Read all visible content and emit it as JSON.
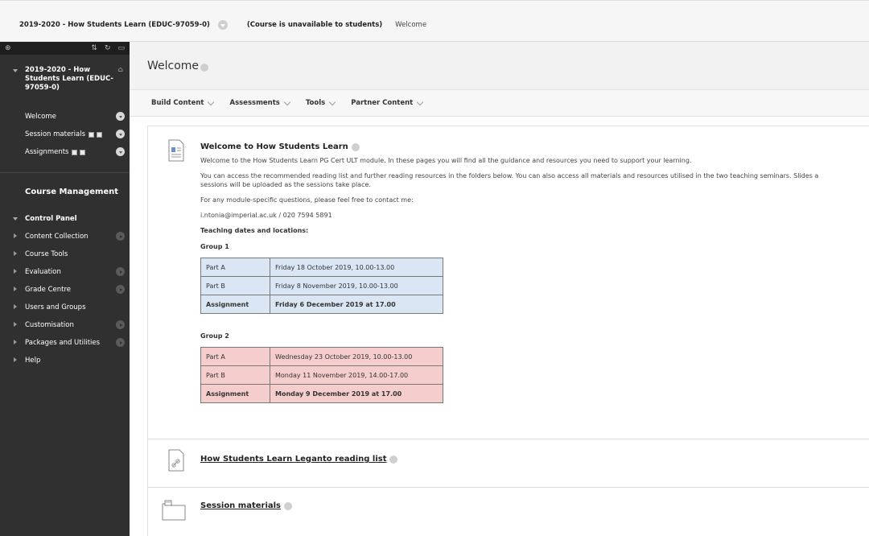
{
  "breadcrumb": {
    "course": "2019-2020 - How Students Learn (EDUC-97059-0)",
    "status": "(Course is unavailable to students)",
    "page": "Welcome"
  },
  "sidebar": {
    "course_title": "2019-2020 - How Students Learn (EDUC-97059-0)",
    "items": [
      {
        "label": "Welcome"
      },
      {
        "label": "Session materials"
      },
      {
        "label": "Assignments"
      }
    ],
    "course_management": "Course Management",
    "control_panel": "Control Panel",
    "cp_items": [
      {
        "label": "Content Collection"
      },
      {
        "label": "Course Tools"
      },
      {
        "label": "Evaluation"
      },
      {
        "label": "Grade Centre"
      },
      {
        "label": "Users and Groups"
      },
      {
        "label": "Customisation"
      },
      {
        "label": "Packages and Utilities"
      },
      {
        "label": "Help"
      }
    ]
  },
  "page": {
    "title": "Welcome",
    "actions": [
      "Build Content",
      "Assessments",
      "Tools",
      "Partner Content"
    ]
  },
  "welcome_item": {
    "title": "Welcome to How Students Learn",
    "p1": "Welcome to the How Students Learn PG Cert ULT module. In these pages you will find all the guidance and resources you need to support your learning.",
    "p2a": "You can access the recommended reading list and further reading resources in the folders below. You can also access all materials and resources utilised in the two teaching seminars. Slides a",
    "p2b": "sessions will be uploaded as the sessions take place.",
    "p3": "For any module-specific questions, please feel free to contact me:",
    "contact": "i.ntonia@imperial.ac.uk / 020 7594 5891",
    "dates_heading": "Teaching dates and locations:",
    "group1": {
      "heading": "Group 1",
      "rows": [
        [
          "Part A",
          "Friday 18 October 2019, 10.00-13.00"
        ],
        [
          "Part B",
          "Friday 8 November 2019, 10.00-13.00"
        ],
        [
          "Assignment",
          "Friday 6 December 2019 at 17.00"
        ]
      ]
    },
    "group2": {
      "heading": "Group 2",
      "rows": [
        [
          "Part A",
          "Wednesday 23 October 2019, 10.00-13.00"
        ],
        [
          "Part B",
          "Monday 11 November 2019, 14.00-17.00"
        ],
        [
          "Assignment",
          "Monday 9 December 2019 at 17.00"
        ]
      ]
    }
  },
  "reading_item": {
    "title": "How Students Learn Leganto reading list"
  },
  "materials_item": {
    "title": "Session materials"
  }
}
